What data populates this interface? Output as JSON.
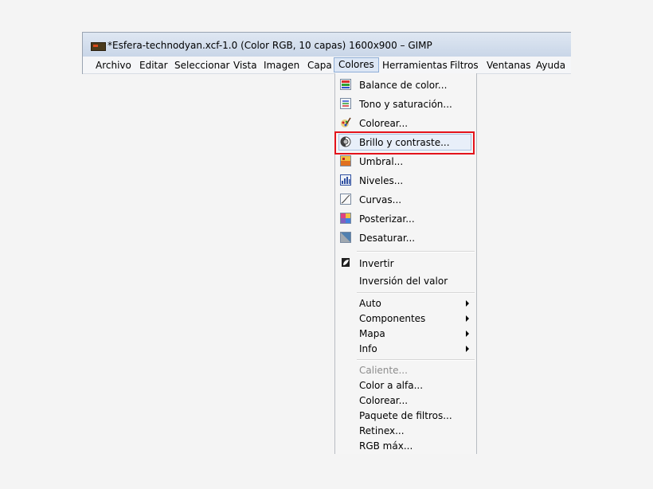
{
  "window": {
    "title": "*Esfera-technodyan.xcf-1.0 (Color RGB, 10 capas) 1600x900 – GIMP"
  },
  "menubar": [
    {
      "label": "Archivo"
    },
    {
      "label": "Editar"
    },
    {
      "label": "Seleccionar"
    },
    {
      "label": "Vista"
    },
    {
      "label": "Imagen"
    },
    {
      "label": "Capa"
    },
    {
      "label": "Colores",
      "active": true
    },
    {
      "label": "Herramientas"
    },
    {
      "label": "Filtros"
    },
    {
      "label": "Ventanas"
    },
    {
      "label": "Ayuda"
    }
  ],
  "colors_menu": {
    "items": [
      {
        "label": "Balance de color...",
        "icon": "color-balance-icon"
      },
      {
        "label": "Tono y saturación...",
        "icon": "hue-saturation-icon"
      },
      {
        "label": "Colorear...",
        "icon": "colorize-icon"
      },
      {
        "label": "Brillo y contraste...",
        "icon": "brightness-contrast-icon",
        "highlighted": true
      },
      {
        "label": "Umbral...",
        "icon": "threshold-icon"
      },
      {
        "label": "Niveles...",
        "icon": "levels-icon"
      },
      {
        "label": "Curvas...",
        "icon": "curves-icon"
      },
      {
        "label": "Posterizar...",
        "icon": "posterize-icon"
      },
      {
        "label": "Desaturar...",
        "icon": "desaturate-icon"
      },
      {
        "label": "Invertir",
        "icon": "invert-icon"
      },
      {
        "label": "Inversión del valor"
      },
      {
        "label": "Auto",
        "submenu": true
      },
      {
        "label": "Componentes",
        "submenu": true
      },
      {
        "label": "Mapa",
        "submenu": true
      },
      {
        "label": "Info",
        "submenu": true
      },
      {
        "label": "Caliente...",
        "disabled": true
      },
      {
        "label": "Color a alfa..."
      },
      {
        "label": "Colorear..."
      },
      {
        "label": "Paquete de filtros..."
      },
      {
        "label": "Retinex..."
      },
      {
        "label": "RGB máx..."
      }
    ]
  },
  "colors": {
    "highlight_border": "#e3131b",
    "hover_bg": "#e8eff9"
  }
}
